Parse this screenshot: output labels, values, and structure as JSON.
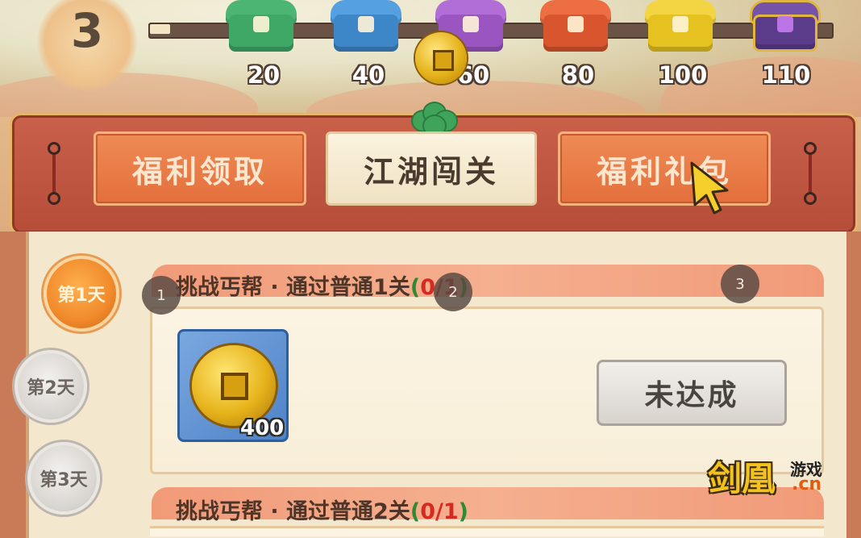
{
  "level": {
    "value": "3"
  },
  "progress": {
    "fraction": 0.03
  },
  "milestones": [
    {
      "value": "20",
      "color": "#3fa866",
      "icon": "chest-green-icon"
    },
    {
      "value": "40",
      "color": "#3d86c8",
      "icon": "chest-blue-icon"
    },
    {
      "value": "60",
      "color": "#9a55c0",
      "icon": "chest-purple-icon"
    },
    {
      "value": "80",
      "color": "#d9552e",
      "icon": "chest-red-icon"
    },
    {
      "value": "100",
      "color": "#e5c220",
      "icon": "chest-gold-icon"
    },
    {
      "value": "110",
      "color": "#5b3c8a",
      "icon": "chest-royal-icon"
    }
  ],
  "tabs": [
    {
      "label": "福利领取",
      "active": false
    },
    {
      "label": "江湖闯关",
      "active": true
    },
    {
      "label": "福利礼包",
      "active": false
    }
  ],
  "days": [
    {
      "label": "第1天",
      "active": true
    },
    {
      "label": "第2天",
      "active": false
    },
    {
      "label": "第3天",
      "active": false
    }
  ],
  "quests": [
    {
      "title": "挑战丐帮 · 通过普通1关",
      "progress_open": "(",
      "progress_count": "0/1",
      "progress_close": ")"
    },
    {
      "title": "挑战丐帮 · 通过普通2关",
      "progress_open": "(",
      "progress_count": "0/1",
      "progress_close": ")"
    }
  ],
  "reward": {
    "quantity": "400",
    "icon": "copper-coin-icon"
  },
  "status_button": {
    "label": "未达成"
  },
  "badges": [
    "1",
    "2",
    "3"
  ],
  "watermark": {
    "main": "剑凰",
    "small": "游戏",
    "domain": ".cn"
  },
  "colors": {
    "accent": "#e36f3c",
    "active_tab": "#f0e2c3",
    "progress_red": "#d52a21",
    "progress_green": "#2d8a34"
  }
}
